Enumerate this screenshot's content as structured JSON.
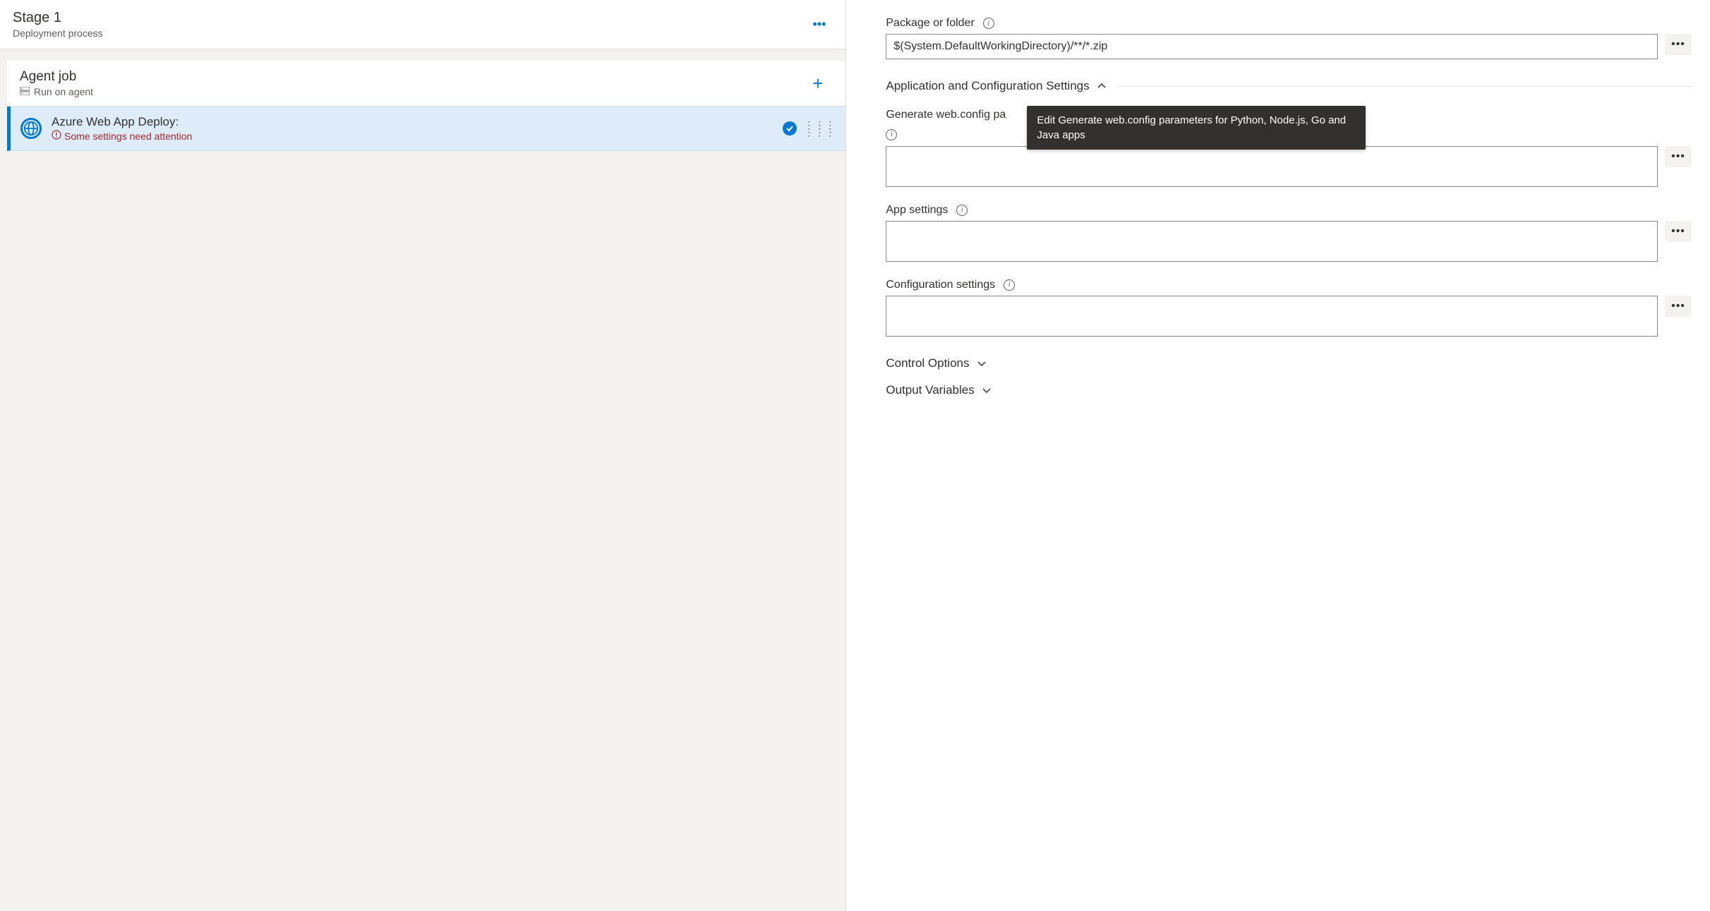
{
  "left": {
    "stage_title": "Stage 1",
    "stage_subtitle": "Deployment process",
    "agent": {
      "title": "Agent job",
      "subtitle": "Run on agent"
    },
    "task": {
      "title": "Azure Web App Deploy:",
      "warning": "Some settings need attention"
    }
  },
  "right": {
    "package_label": "Package or folder",
    "package_value": "$(System.DefaultWorkingDirectory)/**/*.zip",
    "app_config_header": "Application and Configuration Settings",
    "webconfig_label_partial": "Generate web.config pa",
    "tooltip": "Edit Generate web.config parameters for Python, Node.js, Go and Java apps",
    "webconfig_value": "",
    "appsettings_label": "App settings",
    "appsettings_value": "",
    "configsettings_label": "Configuration settings",
    "configsettings_value": "",
    "control_options_header": "Control Options",
    "output_vars_header": "Output Variables"
  }
}
